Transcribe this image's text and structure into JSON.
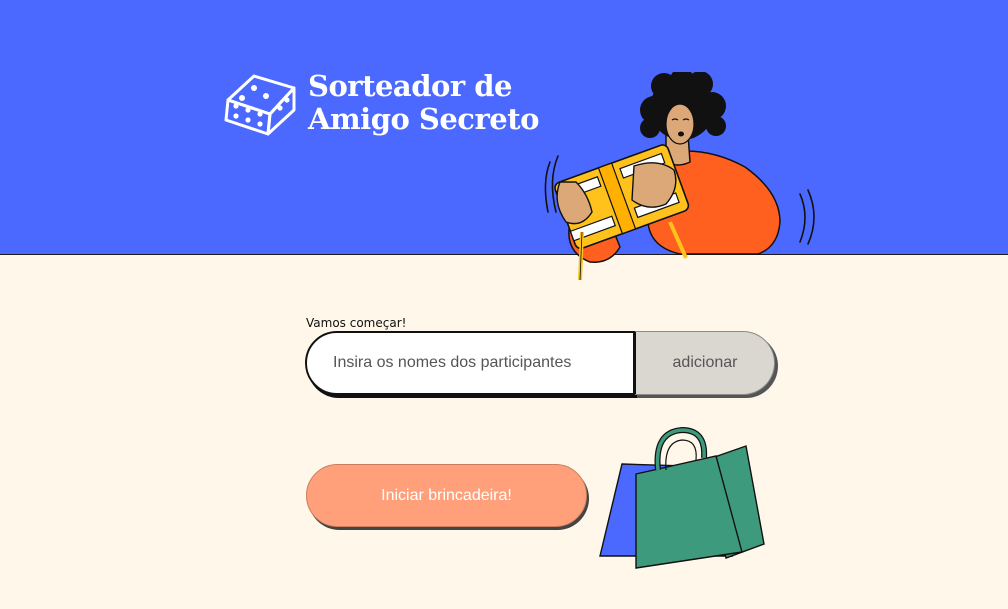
{
  "header": {
    "title_line1": "Sorteador de",
    "title_line2": "Amigo Secreto",
    "background_color": "#4B68FF",
    "logo_icon": "dice-icon",
    "illustration": "person-holding-gift-illustration"
  },
  "form": {
    "label": "Vamos começar!",
    "input_placeholder": "Insira os nomes dos participantes",
    "input_value": "",
    "add_button_label": "adicionar"
  },
  "actions": {
    "start_button_label": "Iniciar brincadeira!",
    "start_button_color": "#FFA07A"
  },
  "decoration": {
    "bags_illustration": "shopping-bags-illustration"
  },
  "colors": {
    "page_background": "#FFF8EA",
    "accent_blue": "#4B68FF",
    "accent_orange": "#FF5F1F",
    "accent_yellow": "#FFC21C",
    "accent_green": "#3E9A7C"
  }
}
